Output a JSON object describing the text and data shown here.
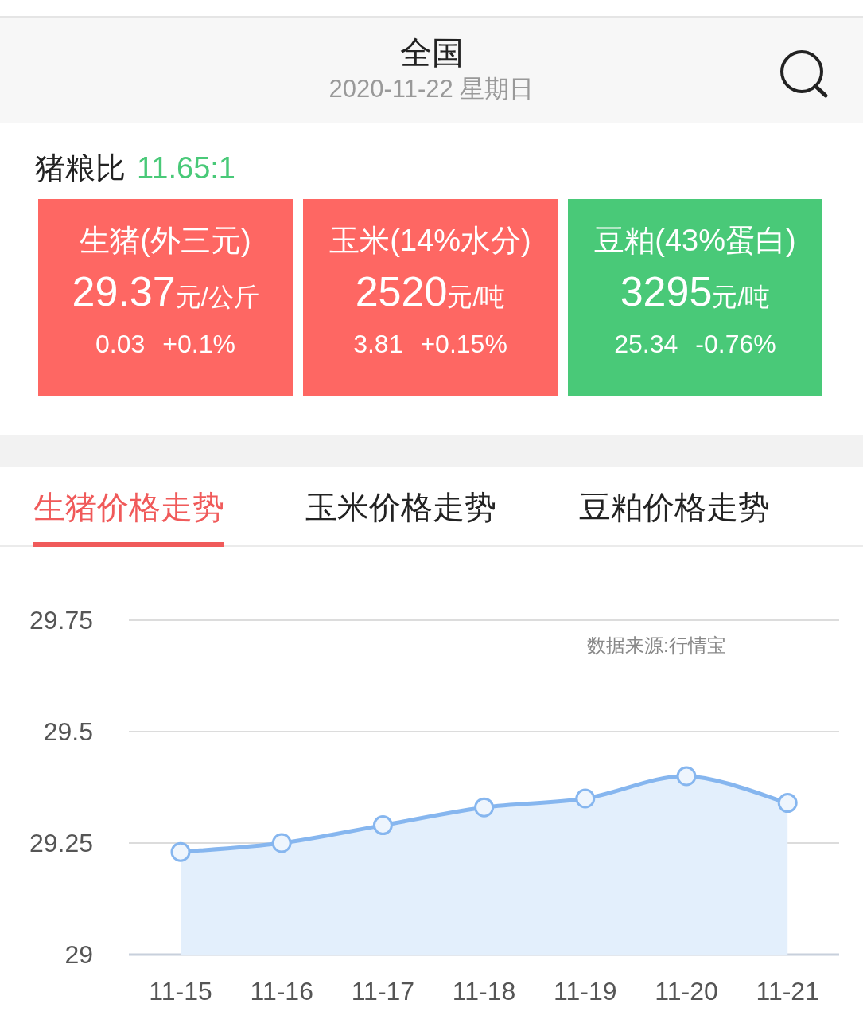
{
  "header": {
    "title": "全国",
    "date": "2020-11-22 星期日"
  },
  "ratio": {
    "label": "猪粮比",
    "value": "11.65:1"
  },
  "cards": [
    {
      "name": "生猪(外三元)",
      "price": "29.37",
      "unit": "元/公斤",
      "change": "0.03",
      "percent": "+0.1%",
      "color": "#fe6763"
    },
    {
      "name": "玉米(14%水分)",
      "price": "2520",
      "unit": "元/吨",
      "change": "3.81",
      "percent": "+0.15%",
      "color": "#fe6763"
    },
    {
      "name": "豆粕(43%蛋白)",
      "price": "3295",
      "unit": "元/吨",
      "change": "25.34",
      "percent": "-0.76%",
      "color": "#49c978"
    }
  ],
  "tabs": [
    {
      "label": "生猪价格走势",
      "selected": true
    },
    {
      "label": "玉米价格走势",
      "selected": false
    },
    {
      "label": "豆粕价格走势",
      "selected": false
    }
  ],
  "chart": {
    "source": "数据来源:行情宝",
    "chart_data": {
      "type": "area",
      "categories": [
        "11-15",
        "11-16",
        "11-17",
        "11-18",
        "11-19",
        "11-20",
        "11-21"
      ],
      "series": [
        {
          "color": "#86b6ef",
          "values": [
            29.23,
            29.25,
            29.29,
            29.33,
            29.35,
            29.4,
            29.34
          ]
        }
      ],
      "ylim": [
        29,
        29.75
      ],
      "yticks": [
        {
          "value": 29,
          "label": "29"
        },
        {
          "value": 29.25,
          "label": "29.25"
        },
        {
          "value": 29.5,
          "label": "29.5"
        },
        {
          "value": 29.75,
          "label": "29.75"
        }
      ]
    }
  }
}
